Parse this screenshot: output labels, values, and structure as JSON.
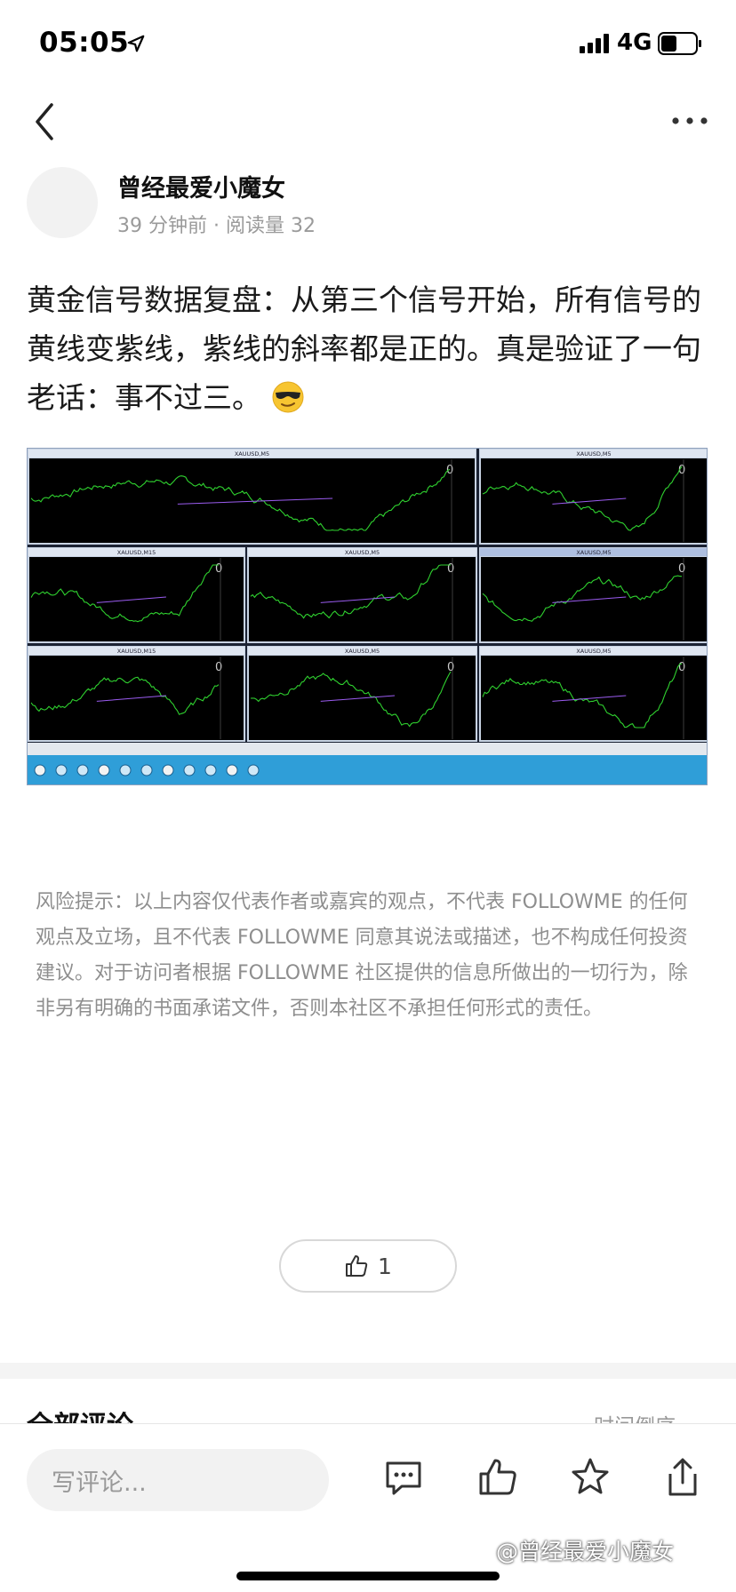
{
  "status_bar": {
    "time": "05:05",
    "network": "4G",
    "icons": [
      "location-arrow-icon",
      "signal-icon",
      "battery-icon"
    ]
  },
  "nav": {
    "back_icon": "chevron-left-icon",
    "more_icon": "ellipsis-icon"
  },
  "author": {
    "name": "曾经最爱小魔女",
    "meta": "39 分钟前 · 阅读量 32"
  },
  "post": {
    "text": "黄金信号数据复盘：从第三个信号开始，所有信号的黄线变紫线，紫线的斜率都是正的。真是验证了一句老话：事不过三。",
    "emoji": "smiling-face-with-sunglasses-icon",
    "image": {
      "panels": [
        {
          "title": "XAUUSD,M5",
          "value": "0"
        },
        {
          "title": "XAUUSD,M5",
          "value": "0"
        },
        {
          "title": "XAUUSD,M15",
          "value": "0"
        },
        {
          "title": "XAUUSD,M5",
          "value": "0"
        },
        {
          "title": "XAUUSD,M5",
          "value": "0"
        },
        {
          "title": "XAUUSD,M15",
          "value": "0"
        },
        {
          "title": "XAUUSD,M5",
          "value": "0"
        },
        {
          "title": "XAUUSD,M5",
          "value": "0"
        }
      ],
      "line_color": "#2fd12f",
      "signal_line_color": "#9b5cf0",
      "background_color": "#000000"
    }
  },
  "disclaimer": "风险提示：以上内容仅代表作者或嘉宾的观点，不代表 FOLLOWME 的任何观点及立场，且不代表 FOLLOWME 同意其说法或描述，也不构成任何投资建议。对于访问者根据 FOLLOWME 社区提供的信息所做出的一切行为，除非另有明确的书面承诺文件，否则本社区不承担任何形式的责任。",
  "like": {
    "icon": "thumbs-up-icon",
    "count": "1"
  },
  "comments": {
    "title": "全部评论",
    "sort_label": "时间倒序 ···"
  },
  "bottom_bar": {
    "comment_placeholder": "写评论...",
    "icons": [
      "comment-icon",
      "thumbs-up-icon",
      "star-icon",
      "share-icon"
    ],
    "watermark": "@曾经最爱小魔女"
  }
}
